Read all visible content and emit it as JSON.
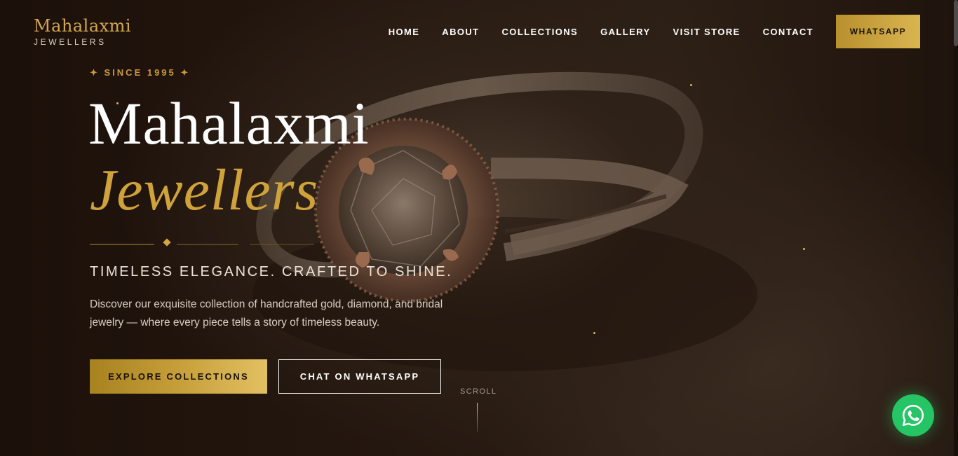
{
  "logo": {
    "name": "Mahalaxmi",
    "subtitle": "JEWELLERS"
  },
  "nav": {
    "items": [
      {
        "label": "HOME"
      },
      {
        "label": "ABOUT"
      },
      {
        "label": "COLLECTIONS"
      },
      {
        "label": "GALLERY"
      },
      {
        "label": "VISIT STORE"
      },
      {
        "label": "CONTACT"
      }
    ],
    "cta_label": "WHATSAPP"
  },
  "hero": {
    "since": "✦ SINCE 1995 ✦",
    "title_line1": "Mahalaxmi",
    "title_line2": "Jewellers",
    "tagline": "TIMELESS ELEGANCE. CRAFTED TO SHINE.",
    "description": "Discover our exquisite collection of handcrafted gold, diamond, and bridal jewelry — where every piece tells a story of timeless beauty.",
    "primary_button": "EXPLORE COLLECTIONS",
    "secondary_button": "CHAT ON WHATSAPP",
    "scroll_label": "SCROLL"
  },
  "icons": {
    "floating_button": "whatsapp-icon",
    "divider_ornament": "diamond-icon"
  },
  "colors": {
    "gold": "#cfa23a",
    "background": "#1e120b",
    "whatsapp_green": "#25c464"
  }
}
